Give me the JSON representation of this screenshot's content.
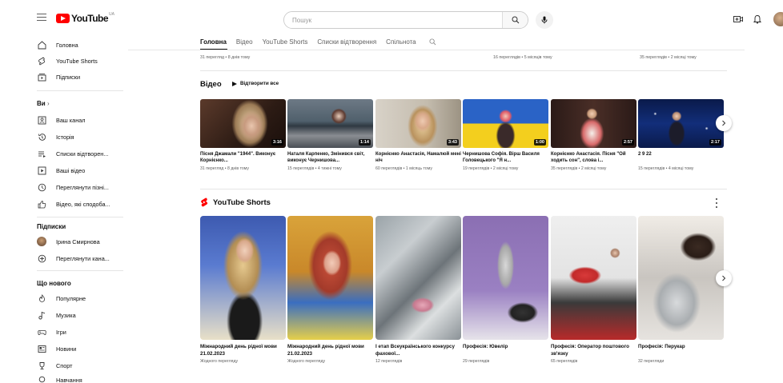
{
  "header": {
    "logo_text": "YouTube",
    "logo_region": "UA",
    "search_placeholder": "Пошук",
    "colors": {
      "brand_red": "#ff0000"
    }
  },
  "sidebar": {
    "main": [
      {
        "label": "Головна",
        "icon": "home-icon"
      },
      {
        "label": "YouTube Shorts",
        "icon": "shorts-icon"
      },
      {
        "label": "Підписки",
        "icon": "subscriptions-icon"
      }
    ],
    "you_heading": "Ви",
    "you": [
      {
        "label": "Ваш канал",
        "icon": "channel-icon"
      },
      {
        "label": "Історія",
        "icon": "history-icon"
      },
      {
        "label": "Списки відтворен...",
        "icon": "playlists-icon"
      },
      {
        "label": "Ваші відео",
        "icon": "your-videos-icon"
      },
      {
        "label": "Переглянути пізні...",
        "icon": "watch-later-icon"
      },
      {
        "label": "Відео, які сподоба...",
        "icon": "liked-icon"
      }
    ],
    "subs_heading": "Підписки",
    "subs": [
      {
        "label": "Ірина Смирнова",
        "icon": "avatar"
      },
      {
        "label": "Переглянути кана...",
        "icon": "add-circle-icon"
      }
    ],
    "explore_heading": "Що нового",
    "explore": [
      {
        "label": "Популярне",
        "icon": "trending-icon"
      },
      {
        "label": "Музика",
        "icon": "music-icon"
      },
      {
        "label": "Ігри",
        "icon": "gaming-icon"
      },
      {
        "label": "Новини",
        "icon": "news-icon"
      },
      {
        "label": "Спорт",
        "icon": "sports-icon"
      },
      {
        "label": "Навчання",
        "icon": "learning-icon"
      }
    ]
  },
  "tabs": [
    "Головна",
    "Відео",
    "YouTube Shorts",
    "Списки відтворення",
    "Спільнота"
  ],
  "prev_row_meta": [
    "31 перегляд • 8 днів тому",
    "16 переглядів • 5 місяців тому",
    "35 переглядів • 2 місяці тому"
  ],
  "videos": {
    "title": "Відео",
    "play_all": "Відтворити все",
    "items": [
      {
        "title": "Пісня Джамали \"1944\". Виконує Корнієнко...",
        "meta": "31 перегляд • 8 днів тому",
        "duration": "3:16"
      },
      {
        "title": "Наталя Карпенко, Змінився світ, виконує Чернишова...",
        "meta": "15 переглядів • 4 тижні тому",
        "duration": "1:14"
      },
      {
        "title": "Корнієнко Анастасія, Намалюй мені ніч",
        "meta": "60 переглядів • 1 місяць тому",
        "duration": "3:43"
      },
      {
        "title": "Чернишова Софія. Вірш Василя Голов­ецького \"Я н...",
        "meta": "19 переглядів • 2 місяці тому",
        "duration": "1:00"
      },
      {
        "title": "Корнієнко Анастасія. Пісня \"Ой ходить сон\", слова і...",
        "meta": "35 переглядів • 2 місяці тому",
        "duration": "2:57"
      },
      {
        "title": "2 9 22",
        "meta": "15 переглядів • 4 місяці тому",
        "duration": "2:17"
      }
    ]
  },
  "shorts": {
    "title": "YouTube Shorts",
    "items": [
      {
        "title": "Міжнародний день рідної мови 21.02.2023",
        "meta": "Жодного перегляду"
      },
      {
        "title": "Міжнародний день рідної мови 21.02.2023",
        "meta": "Жодного перегляду"
      },
      {
        "title": "І етап Всеукраїнського конкурсу фахової...",
        "meta": "12 переглядів"
      },
      {
        "title": "Професія: Ювелір",
        "meta": "29 переглядів"
      },
      {
        "title": "Професія: Оператор поштового зв'язку",
        "meta": "65 переглядів"
      },
      {
        "title": "Професія: Перукар",
        "meta": "32 перегляди"
      }
    ]
  }
}
